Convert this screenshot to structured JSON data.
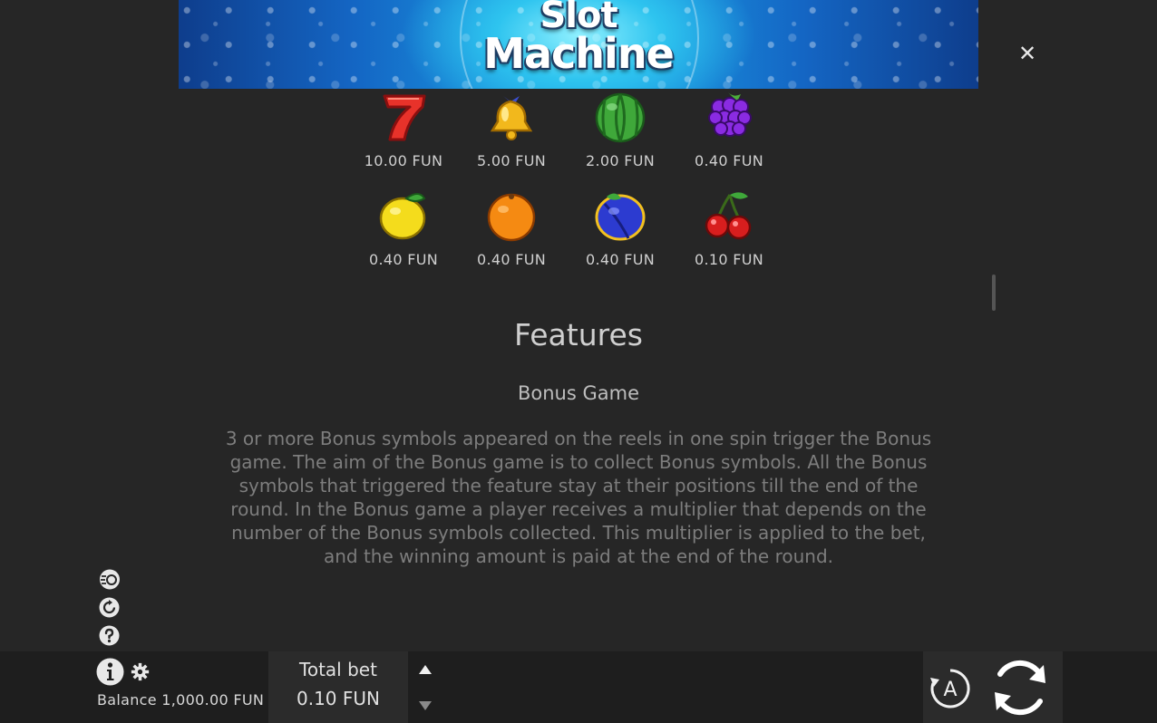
{
  "banner": {
    "logo_line1": "Slot",
    "logo_line2": "Machine"
  },
  "close": {
    "label": "✕"
  },
  "paytable": [
    {
      "symbol": "seven-icon",
      "value": "10.00 FUN"
    },
    {
      "symbol": "bell-icon",
      "value": "5.00 FUN"
    },
    {
      "symbol": "watermelon-icon",
      "value": "2.00 FUN"
    },
    {
      "symbol": "grapes-icon",
      "value": "0.40 FUN"
    },
    {
      "symbol": "lemon-icon",
      "value": "0.40 FUN"
    },
    {
      "symbol": "orange-icon",
      "value": "0.40 FUN"
    },
    {
      "symbol": "plum-icon",
      "value": "0.40 FUN"
    },
    {
      "symbol": "cherry-icon",
      "value": "0.10 FUN"
    }
  ],
  "features": {
    "title": "Features",
    "bonus_title": "Bonus Game",
    "bonus_text": "3 or more Bonus symbols appeared on the reels in one spin trigger the Bonus game. The aim of the Bonus game is to collect Bonus symbols. All the Bonus symbols that triggered the feature stay at their positions till the end of the round. In the Bonus game a player receives a multiplier that depends on the number of the Bonus symbols collected. This multiplier is applied to the bet, and the winning amount is paid at the end of the round."
  },
  "side_icons": [
    "turbo-icon",
    "history-icon",
    "help-icon"
  ],
  "bottom": {
    "balance": "Balance 1,000.00 FUN",
    "total_bet_label": "Total bet",
    "total_bet_value": "0.10 FUN",
    "auto_label": "A"
  },
  "colors": {
    "background": "#262626",
    "bar": "#1e1e1e",
    "panel": "#2b2b2b",
    "banner_accent": "#1a9be3"
  }
}
